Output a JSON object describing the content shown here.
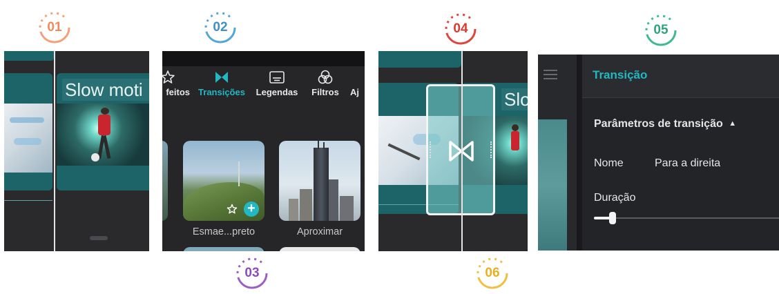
{
  "steps": [
    "01",
    "02",
    "03",
    "04",
    "05",
    "06"
  ],
  "colors": {
    "step01": "#f4a07a",
    "step02": "#4fa8d8",
    "step03": "#9b5fc4",
    "step04": "#e0443a",
    "step05": "#3fb894",
    "step06": "#f0c040",
    "accent": "#21b8c4",
    "timeline_clip": "#1d6468"
  },
  "panel1": {
    "clip_title": "Slow moti"
  },
  "panel2": {
    "tabs": [
      {
        "label": "feitos",
        "icon": "effects-star-icon"
      },
      {
        "label": "Transições",
        "icon": "transitions-bowtie-icon",
        "active": true
      },
      {
        "label": "Legendas",
        "icon": "captions-icon"
      },
      {
        "label": "Filtros",
        "icon": "filters-icon"
      },
      {
        "label": "Aj",
        "icon": "adjust-icon"
      }
    ],
    "items": [
      {
        "label": "Esmae...preto"
      },
      {
        "label": "Aproximar"
      }
    ]
  },
  "panel4": {
    "clip_title": "Slo"
  },
  "panel5": {
    "header": "Transição",
    "section_title": "Parâmetros de transição",
    "name_label": "Nome",
    "name_value": "Para a direita",
    "duration_label": "Duração",
    "duration_fraction": 0.1
  }
}
